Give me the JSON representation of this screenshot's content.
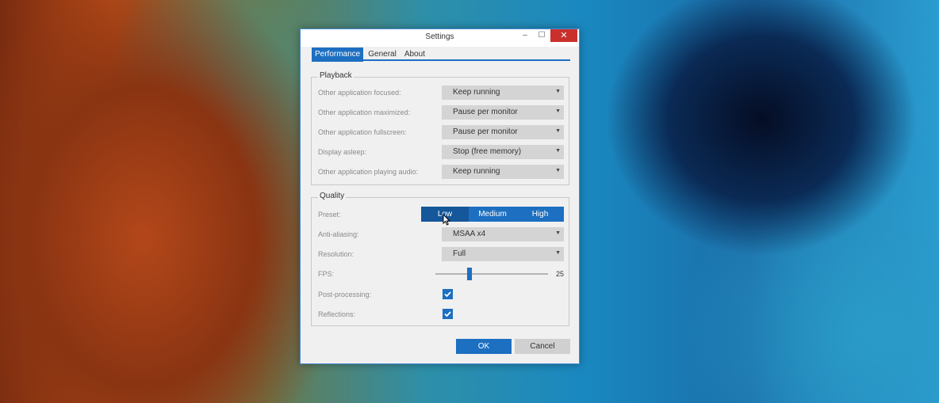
{
  "window": {
    "title": "Settings",
    "controls": {
      "minimize": "–",
      "maximize": "☐",
      "close": "✕"
    }
  },
  "tabs": [
    {
      "label": "Performance",
      "active": true
    },
    {
      "label": "General",
      "active": false
    },
    {
      "label": "About",
      "active": false
    }
  ],
  "playback": {
    "title": "Playback",
    "rows": [
      {
        "label": "Other application focused:",
        "value": "Keep running"
      },
      {
        "label": "Other application maximized:",
        "value": "Pause per monitor"
      },
      {
        "label": "Other application fullscreen:",
        "value": "Pause per monitor"
      },
      {
        "label": "Display asleep:",
        "value": "Stop (free memory)"
      },
      {
        "label": "Other application playing audio:",
        "value": "Keep running"
      }
    ]
  },
  "quality": {
    "title": "Quality",
    "preset": {
      "label": "Preset:",
      "options": [
        "Low",
        "Medium",
        "High"
      ],
      "selected": "Low"
    },
    "antialiasing": {
      "label": "Anti-aliasing:",
      "value": "MSAA x4"
    },
    "resolution": {
      "label": "Resolution:",
      "value": "Full"
    },
    "fps": {
      "label": "FPS:",
      "value": "25",
      "fraction": 0.3
    },
    "postprocessing": {
      "label": "Post-processing:",
      "checked": true
    },
    "reflections": {
      "label": "Reflections:",
      "checked": true
    }
  },
  "buttons": {
    "ok": "OK",
    "cancel": "Cancel"
  },
  "colors": {
    "accent": "#1d6fc1",
    "close": "#c9302c",
    "panel": "#f0f0f0"
  },
  "icons": {
    "dropdown": "chevron-down-icon",
    "check": "check-icon",
    "cursor": "mouse-pointer-icon"
  }
}
